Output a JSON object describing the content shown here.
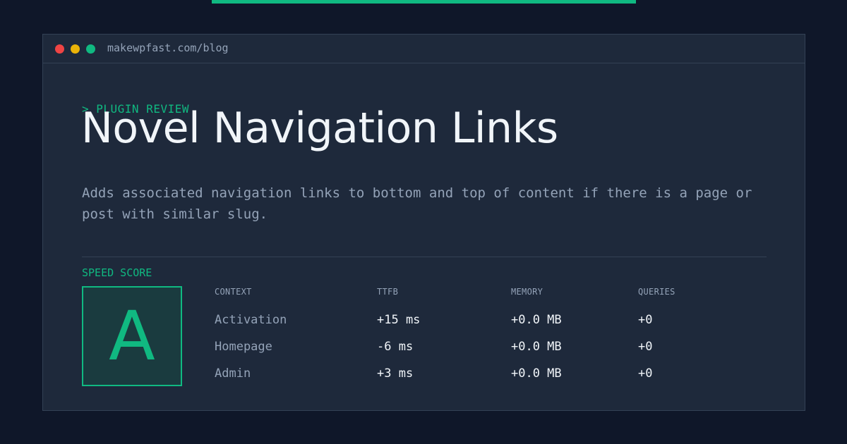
{
  "window": {
    "url": "makewpfast.com/blog"
  },
  "hero": {
    "tagline": "> PLUGIN REVIEW",
    "title": "Novel Navigation Links",
    "description": "Adds associated navigation links to bottom and top of content if there is a page or post with similar slug."
  },
  "score": {
    "label": "SPEED SCORE",
    "grade": "A"
  },
  "metrics": {
    "headers": [
      "CONTEXT",
      "TTFB",
      "MEMORY",
      "QUERIES"
    ],
    "rows": [
      [
        "Activation",
        "+15 ms",
        "+0.0 MB",
        "+0"
      ],
      [
        "Homepage",
        "-6 ms",
        "+0.0 MB",
        "+0"
      ],
      [
        "Admin",
        "+3 ms",
        "+0.0 MB",
        "+0"
      ]
    ]
  },
  "colors": {
    "accent": "#10b981",
    "background": "#0f1729",
    "panel": "#1e293b"
  }
}
